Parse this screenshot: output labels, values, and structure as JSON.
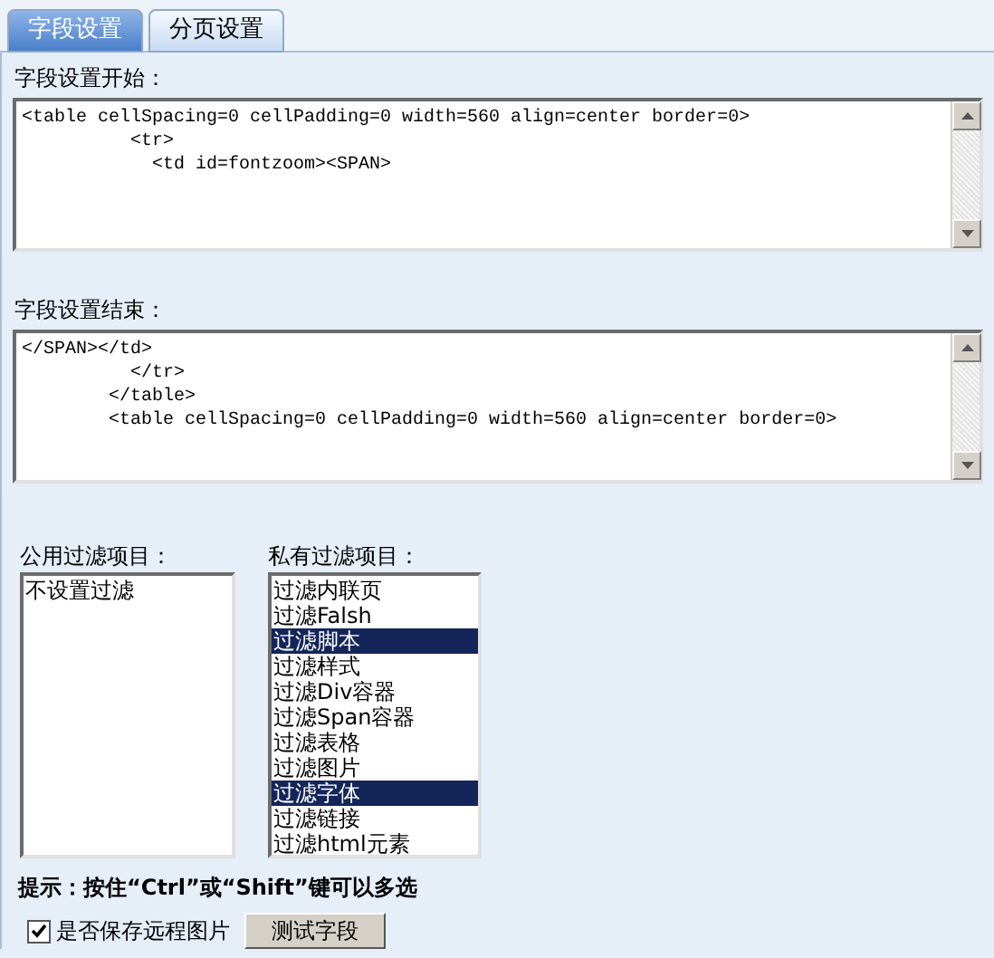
{
  "tabs": [
    {
      "label": "字段设置",
      "selected": true
    },
    {
      "label": "分页设置",
      "selected": false
    }
  ],
  "start_section": {
    "label": "字段设置开始：",
    "lines": [
      "<table cellSpacing=0 cellPadding=0 width=560 align=center border=0>",
      "          <tr>",
      "            <td id=fontzoom><SPAN>"
    ]
  },
  "end_section": {
    "label": "字段设置结束：",
    "lines": [
      "</SPAN></td>",
      "          </tr>",
      "        </table>",
      "        <table cellSpacing=0 cellPadding=0 width=560 align=center border=0>"
    ]
  },
  "public_filters": {
    "label": "公用过滤项目：",
    "items": [
      {
        "label": "不设置过滤",
        "selected": false
      }
    ]
  },
  "private_filters": {
    "label": "私有过滤项目：",
    "items": [
      {
        "label": "过滤内联页",
        "selected": false
      },
      {
        "label": "过滤Falsh",
        "selected": false
      },
      {
        "label": "过滤脚本",
        "selected": true
      },
      {
        "label": "过滤样式",
        "selected": false
      },
      {
        "label": "过滤Div容器",
        "selected": false
      },
      {
        "label": "过滤Span容器",
        "selected": false
      },
      {
        "label": "过滤表格",
        "selected": false
      },
      {
        "label": "过滤图片",
        "selected": false
      },
      {
        "label": "过滤字体",
        "selected": true
      },
      {
        "label": "过滤链接",
        "selected": false
      },
      {
        "label": "过滤html元素",
        "selected": false
      }
    ]
  },
  "hint": "提示：按住“Ctrl”或“Shift”键可以多选",
  "save_remote_images": {
    "label": "是否保存远程图片",
    "checked": true
  },
  "test_button": "测试字段"
}
